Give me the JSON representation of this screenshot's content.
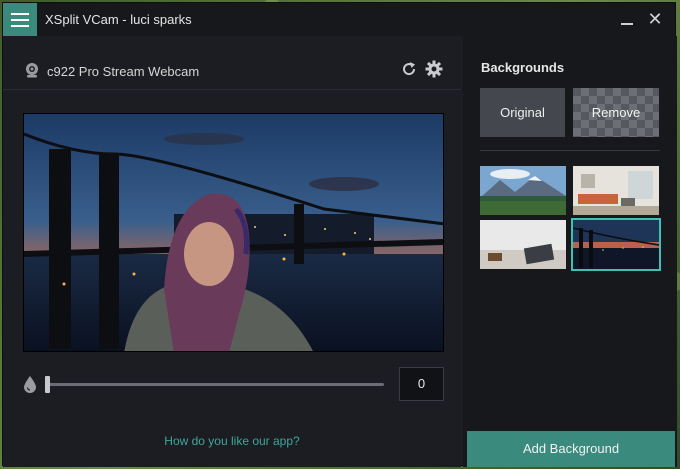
{
  "window": {
    "title": "XSplit VCam - luci sparks"
  },
  "titlebar": {
    "close_glyph": "✕"
  },
  "device": {
    "name": "c922 Pro Stream Webcam"
  },
  "slider": {
    "value": "0",
    "level": 0
  },
  "feedback": {
    "text": "How do you like our app?"
  },
  "backgrounds": {
    "title": "Backgrounds",
    "original_label": "Original",
    "remove_label": "Remove",
    "add_label": "Add Background",
    "selected_index": 3
  },
  "colors": {
    "accent": "#3a8a7d",
    "selected_border": "#3cc1b4",
    "link": "#3ea79a"
  }
}
